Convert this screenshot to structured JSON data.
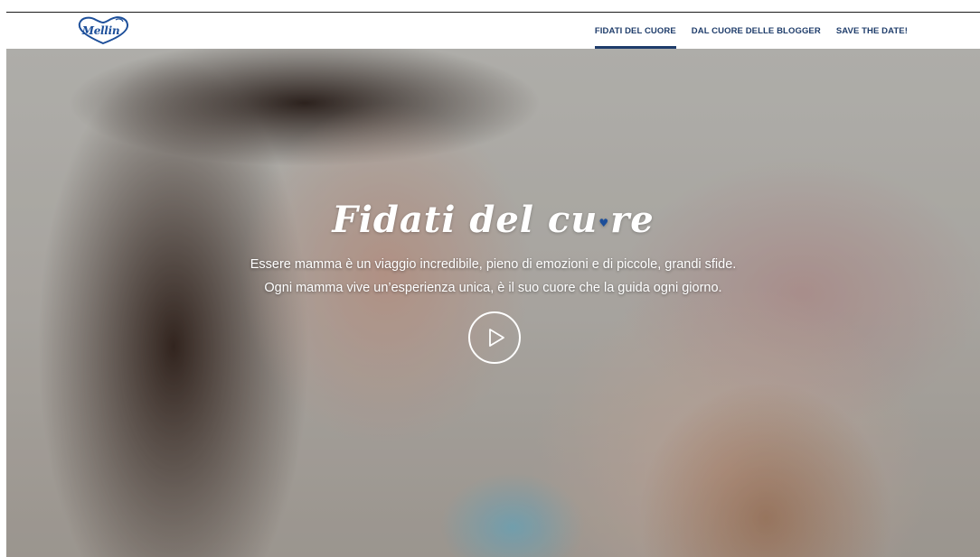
{
  "header": {
    "logo_text": "Mellin"
  },
  "nav": {
    "items": [
      {
        "label": "FIDATI DEL CUORE",
        "active": true
      },
      {
        "label": "DAL CUORE DELLE BLOGGER",
        "active": false
      },
      {
        "label": "SAVE THE DATE!",
        "active": false
      }
    ]
  },
  "hero": {
    "title_part1": "Fidati del cu",
    "title_part2": "re",
    "heart_glyph": "♥",
    "line1": "Essere mamma è un viaggio incredibile, pieno di emozioni e di piccole, grandi sfide.",
    "line2": "Ogni mamma vive un’esperienza unica, è il suo cuore che la guida ogni giorno.",
    "play_icon": "play-icon"
  },
  "colors": {
    "brand_blue": "#1d4f9a",
    "nav_text": "#1f3d6b",
    "white": "#ffffff"
  }
}
